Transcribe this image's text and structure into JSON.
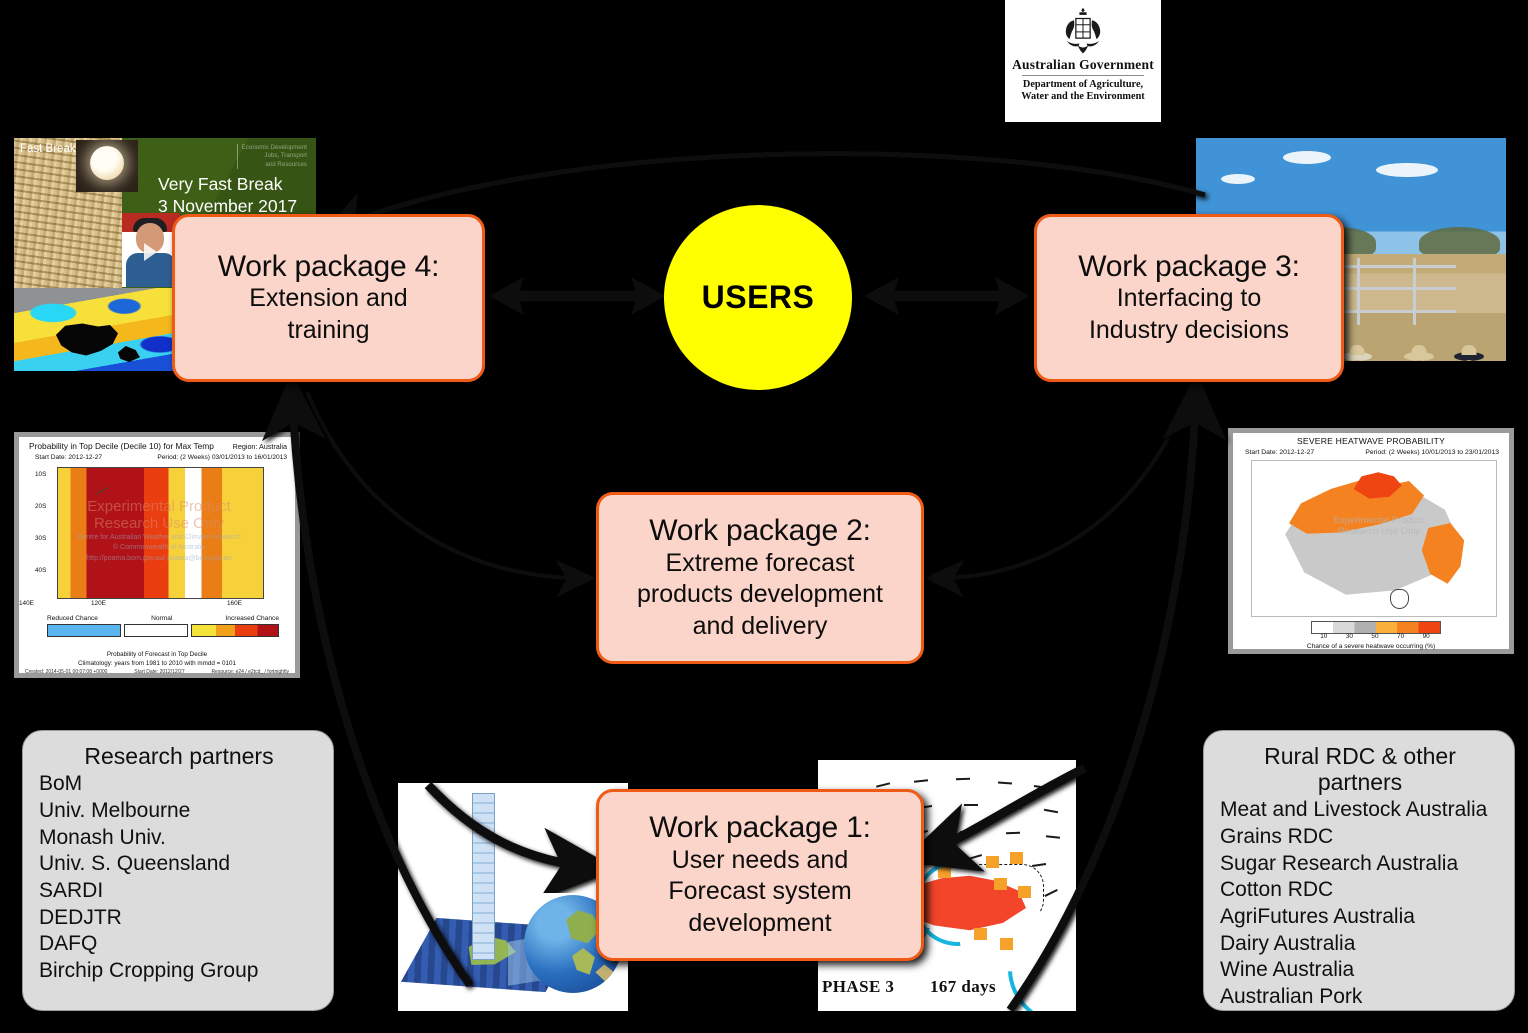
{
  "logo": {
    "crest_alt": "australian-coat-of-arms",
    "title": "Australian Government",
    "department_line1": "Department of Agriculture,",
    "department_line2": "Water and the Environment"
  },
  "center": {
    "users_label": "USERS"
  },
  "work_packages": [
    {
      "id": "wp4",
      "title": "Work package 4:",
      "line1": "Extension and",
      "line2": "training"
    },
    {
      "id": "wp3",
      "title": "Work package 3:",
      "line1": "Interfacing to",
      "line2": "Industry decisions"
    },
    {
      "id": "wp2",
      "title": "Work package 2:",
      "line1": "Extreme forecast",
      "line2": "products development",
      "line3": "and delivery"
    },
    {
      "id": "wp1",
      "title": "Work package 1:",
      "line1": "User needs and",
      "line2": "Forecast system",
      "line3": "development"
    }
  ],
  "research_partners": {
    "heading": "Research partners",
    "items": [
      "BoM",
      "Univ. Melbourne",
      "Monash Univ.",
      "Univ. S. Queensland",
      "SARDI",
      "DEDJTR",
      "DAFQ",
      "Birchip Cropping Group"
    ]
  },
  "rdc_partners": {
    "heading_line1": "Rural RDC  & other",
    "heading_line2": "partners",
    "items": [
      "Meat and Livestock Australia",
      "Grains RDC",
      "Sugar Research Australia",
      "Cotton RDC",
      "AgriFutures Australia",
      "Dairy Australia",
      "Wine Australia",
      "Australian Pork"
    ]
  },
  "very_fast_break": {
    "corner_label": "Fast Break",
    "title": "Very Fast Break",
    "date": "3 November 2017",
    "org_line1": "Economic Development",
    "org_line2": "Jobs, Transport",
    "org_line3": "and Resources"
  },
  "decile_map": {
    "title": "Probability in Top Decile (Decile 10) for Max Temp",
    "region": "Region: Australia",
    "start_date": "Start Date: 2012-12-27",
    "period": "Period: (2 Weeks) 03/01/2013 to 16/01/2013",
    "watermark_line1": "Experimental Product",
    "watermark_line2": "Research Use Only",
    "watermark_line3": "Centre for Australian Weather and Climate Research",
    "watermark_line4": "© Commonwealth of Australia",
    "watermark_line5": "http://poama.bom.gov.au/          poama@bom.gov.au",
    "y_ticks": [
      "10S",
      "20S",
      "30S",
      "40S"
    ],
    "x_ticks": [
      "120E",
      "140E",
      "160E"
    ],
    "legend_reduced": "Reduced Chance",
    "legend_normal": "Normal",
    "legend_increased": "Increased Chance",
    "legend_caption": "Probability of Forecast in Top Decile",
    "climatology": "Climatology: years from 1981 to 2010 with mmdd = 0101",
    "footer_left": "Created: 2014-05-01 00:07:08 +0000",
    "footer_center": "Start Date: 2012/12/27",
    "footer_right": "Resource: e24 / e2tcd_ / fortnightly"
  },
  "heatwave_map": {
    "title": "SEVERE HEATWAVE PROBABILITY",
    "start_date": "Start Date: 2012-12-27",
    "period": "Period: (2 Weeks) 10/01/2013 to 23/01/2013",
    "watermark_line1": "Experimental Product",
    "watermark_line2": "Research Use Only",
    "legend_ticks": [
      "10",
      "30",
      "50",
      "70",
      "90"
    ],
    "legend_caption": "Chance of a severe heatwave occurring (%)"
  },
  "mjo_map": {
    "phase_label": "PHASE 3",
    "days_label": "167 days"
  },
  "photos": {
    "farmers_alt": "farmers-field-day-photo",
    "model_alt": "climate-model-grid-and-globe"
  },
  "colors": {
    "background": "#000000",
    "wp_fill": "#fbd5c9",
    "wp_border": "#ef5a17",
    "users_fill": "#ffff00",
    "partner_fill": "#dcdcdc"
  }
}
